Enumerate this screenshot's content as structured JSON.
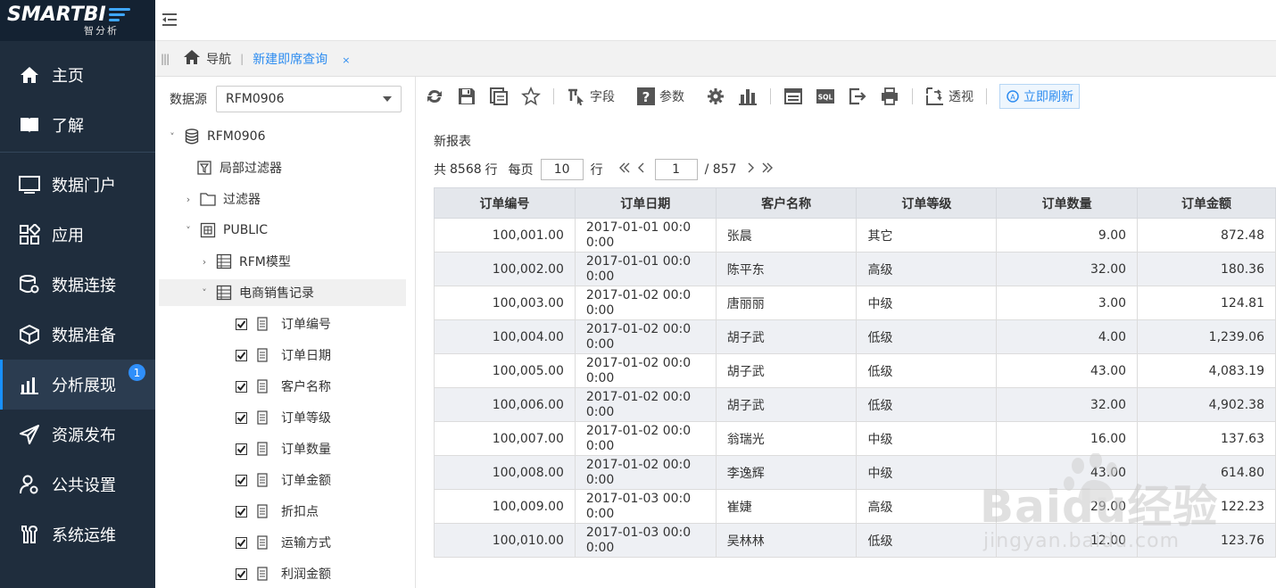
{
  "app": {
    "logo_text": "SMARTBI",
    "logo_sub": "智分析"
  },
  "sidebar": {
    "items": [
      {
        "label": "主页",
        "icon": "home-icon"
      },
      {
        "label": "了解",
        "icon": "book-icon"
      },
      {
        "label": "数据门户",
        "icon": "monitor-icon"
      },
      {
        "label": "应用",
        "icon": "apps-icon"
      },
      {
        "label": "数据连接",
        "icon": "database-gear-icon"
      },
      {
        "label": "数据准备",
        "icon": "cube-icon"
      },
      {
        "label": "分析展现",
        "icon": "bar-chart-icon",
        "badge": "1"
      },
      {
        "label": "资源发布",
        "icon": "send-icon"
      },
      {
        "label": "公共设置",
        "icon": "user-gear-icon"
      },
      {
        "label": "系统运维",
        "icon": "tools-icon"
      }
    ],
    "active_index": 6
  },
  "tabs": {
    "home_label": "导航",
    "active_tab": "新建即席查询",
    "close": "×"
  },
  "tree": {
    "datasource_label": "数据源",
    "datasource_value": "RFM0906",
    "root": "RFM0906",
    "local_filter": "局部过滤器",
    "filter": "过滤器",
    "schema": "PUBLIC",
    "table1": "RFM模型",
    "table2": "电商销售记录",
    "fields": [
      "订单编号",
      "订单日期",
      "客户名称",
      "订单等级",
      "订单数量",
      "订单金额",
      "折扣点",
      "运输方式",
      "利润金额"
    ]
  },
  "toolbar": {
    "fields_label": "字段",
    "params_label": "参数",
    "pivot_label": "透视",
    "refresh_label": "立即刷新",
    "sql_label": "SQL"
  },
  "report": {
    "title": "新报表",
    "total_prefix": "共",
    "total_count": "8568",
    "total_suffix": "行",
    "per_page_label": "每页",
    "per_page_value": "10",
    "per_page_suffix": "行",
    "current_page": "1",
    "total_pages": "/ 857",
    "columns": [
      "订单编号",
      "订单日期",
      "客户名称",
      "订单等级",
      "订单数量",
      "订单金额"
    ],
    "rows": [
      [
        "100,001.00",
        "2017-01-01  00:0\n0:00",
        "张晨",
        "其它",
        "9.00",
        "872.48"
      ],
      [
        "100,002.00",
        "2017-01-01  00:0\n0:00",
        "陈平东",
        "高级",
        "32.00",
        "180.36"
      ],
      [
        "100,003.00",
        "2017-01-02  00:0\n0:00",
        "唐丽丽",
        "中级",
        "3.00",
        "124.81"
      ],
      [
        "100,004.00",
        "2017-01-02  00:0\n0:00",
        "胡子武",
        "低级",
        "4.00",
        "1,239.06"
      ],
      [
        "100,005.00",
        "2017-01-02  00:0\n0:00",
        "胡子武",
        "低级",
        "43.00",
        "4,083.19"
      ],
      [
        "100,006.00",
        "2017-01-02  00:0\n0:00",
        "胡子武",
        "低级",
        "32.00",
        "4,902.38"
      ],
      [
        "100,007.00",
        "2017-01-02  00:0\n0:00",
        "翁瑞光",
        "中级",
        "16.00",
        "137.63"
      ],
      [
        "100,008.00",
        "2017-01-02  00:0\n0:00",
        "李逸辉",
        "中级",
        "43.00",
        "614.80"
      ],
      [
        "100,009.00",
        "2017-01-03  00:0\n0:00",
        "崔婕",
        "高级",
        "29.00",
        "122.23"
      ],
      [
        "100,010.00",
        "2017-01-03  00:0\n0:00",
        "吴林林",
        "低级",
        "12.00",
        "123.76"
      ]
    ]
  },
  "watermark": {
    "text": "Baidu经验",
    "url": "jingyan.baidu.com"
  },
  "colors": {
    "sidebar_bg": "#1f2d3d",
    "accent": "#2d8cf0",
    "badge": "#2f8ffa"
  }
}
